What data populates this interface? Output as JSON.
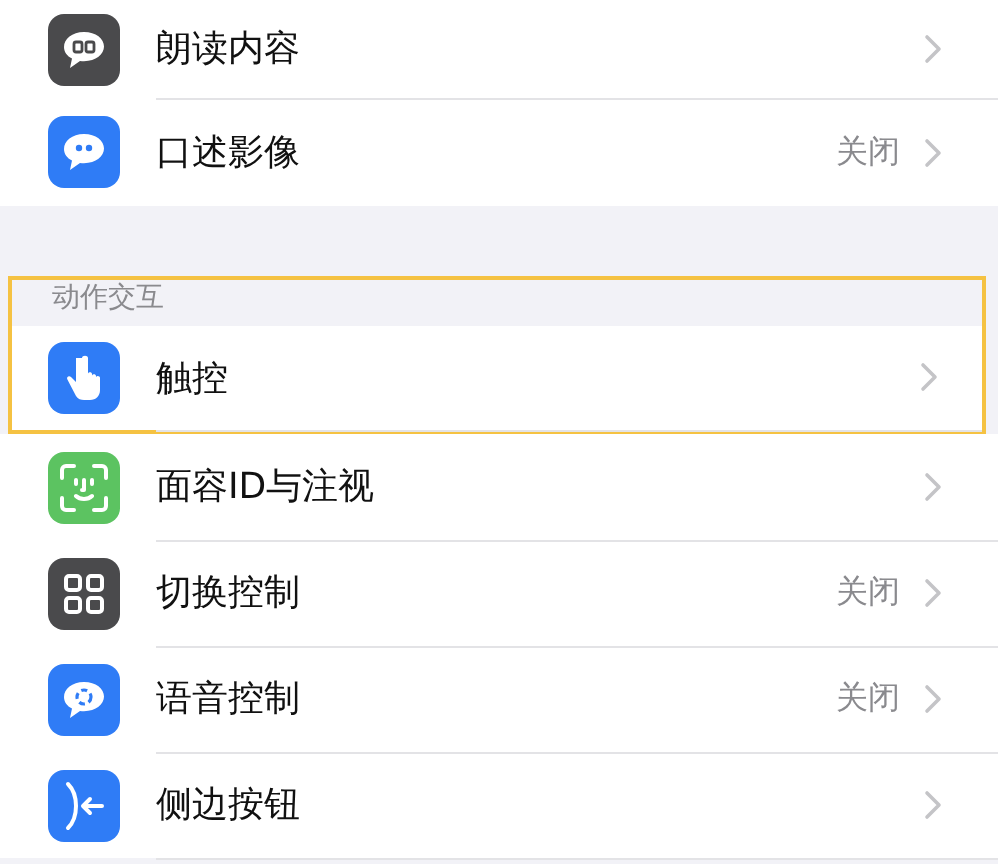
{
  "sections": [
    {
      "items": [
        {
          "kind": "speech",
          "label": "朗读内容"
        },
        {
          "kind": "quote",
          "label": "口述影像",
          "value": "关闭"
        }
      ]
    },
    {
      "header": "动作交互",
      "highlighted": true,
      "items": [
        {
          "kind": "hand",
          "label": "触控"
        },
        {
          "kind": "face",
          "label": "面容ID与注视"
        },
        {
          "kind": "grid",
          "label": "切换控制",
          "value": "关闭"
        },
        {
          "kind": "voice",
          "label": "语音控制",
          "value": "关闭"
        },
        {
          "kind": "side",
          "label": "侧边按钮"
        }
      ]
    }
  ]
}
